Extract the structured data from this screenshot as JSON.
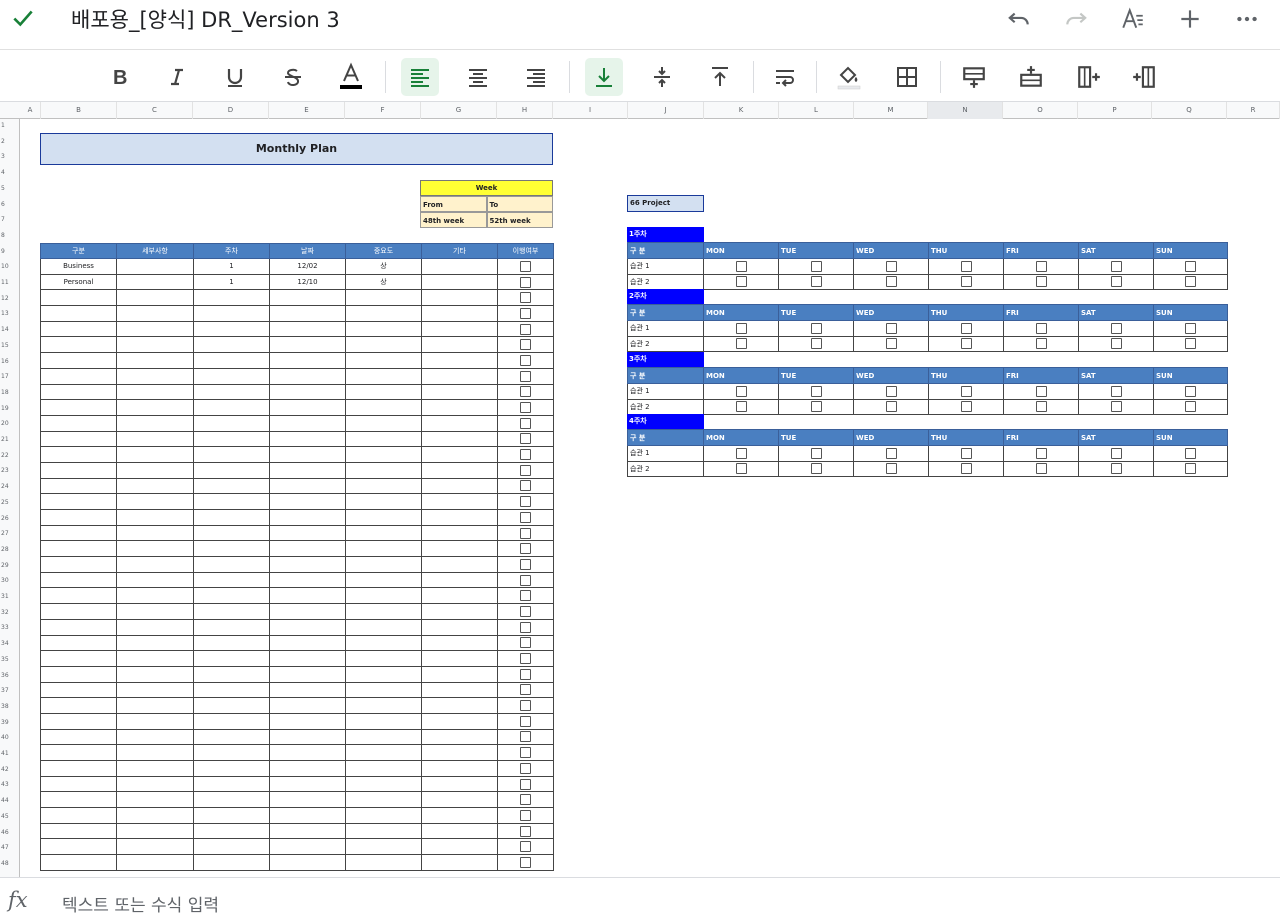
{
  "doc": {
    "title": "배포용_[양식] DR_Version 3"
  },
  "icons": {
    "done": "check-icon",
    "undo": "undo-icon",
    "redo": "redo-icon",
    "text_format": "text-format-icon",
    "insert": "plus-icon",
    "more": "more-vert-icon"
  },
  "toolbar": {
    "items": [
      "bold",
      "italic",
      "underline",
      "strikethrough",
      "text-color",
      "align-left",
      "align-center",
      "align-right",
      "valign-bottom",
      "valign-middle",
      "valign-top",
      "text-wrap",
      "fill-color",
      "borders",
      "insert-row-above",
      "insert-row-below",
      "insert-column-right",
      "insert-column-left"
    ],
    "active": [
      "align-left",
      "valign-bottom"
    ]
  },
  "columns": [
    "A",
    "B",
    "C",
    "D",
    "E",
    "F",
    "G",
    "H",
    "I",
    "J",
    "K",
    "L",
    "M",
    "N",
    "O",
    "P",
    "Q",
    "R"
  ],
  "selected_column": "N",
  "rows": [
    "1",
    "2",
    "3",
    "4",
    "5",
    "6",
    "7",
    "8",
    "9",
    "10",
    "11",
    "12",
    "13",
    "14",
    "15",
    "16",
    "17",
    "18",
    "19",
    "20",
    "21",
    "22",
    "23",
    "24",
    "25",
    "26",
    "27",
    "28",
    "29",
    "30",
    "31",
    "32",
    "33",
    "34",
    "35",
    "36",
    "37",
    "38",
    "39",
    "40",
    "41",
    "42",
    "43",
    "44",
    "45",
    "46",
    "47",
    "48"
  ],
  "sheet": {
    "monthly_title": "Monthly Plan",
    "week": {
      "header": "Week",
      "from_label": "From",
      "to_label": "To",
      "from_value": "48th week",
      "to_value": "52th week"
    },
    "plan_headers": [
      "구분",
      "세부사항",
      "주차",
      "날짜",
      "중요도",
      "기타",
      "이행여부"
    ],
    "plan_rows": [
      {
        "cat": "Business",
        "detail": "",
        "week": "1",
        "date": "12/02",
        "priority": "상",
        "etc": ""
      },
      {
        "cat": "Personal",
        "detail": "",
        "week": "1",
        "date": "12/10",
        "priority": "상",
        "etc": ""
      }
    ],
    "plan_empty_rows": 37,
    "project_label": "66 Project",
    "habit_header_label": "구 분",
    "days": [
      "MON",
      "TUE",
      "WED",
      "THU",
      "FRI",
      "SAT",
      "SUN"
    ],
    "habit_weeks": [
      "1주차",
      "2주차",
      "3주차",
      "4주차"
    ],
    "habit_rows": [
      "습관 1",
      "습관 2"
    ]
  },
  "formula_bar": {
    "placeholder": "텍스트 또는 수식 입력"
  },
  "colors": {
    "accent": "#188038",
    "header_blue": "#4a7fc1",
    "week_blue": "#0000ff",
    "title_fill": "#d3e0f1",
    "week_yellow": "#ffff33"
  }
}
